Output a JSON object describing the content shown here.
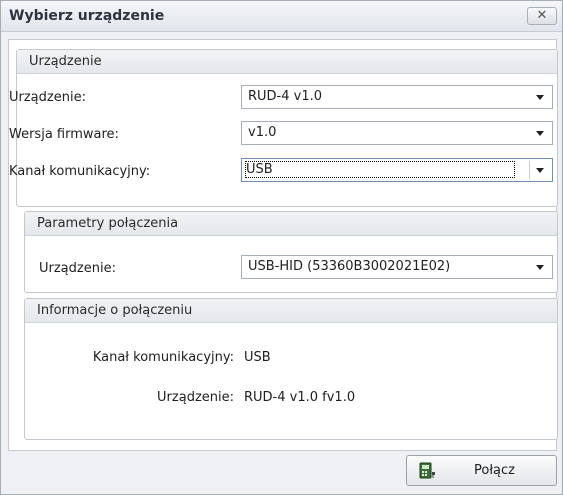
{
  "window": {
    "title": "Wybierz urządzenie",
    "close_glyph": "✕"
  },
  "device_group": {
    "header": "Urządzenie",
    "device_label": "Urządzenie:",
    "device_value": "RUD-4 v1.0",
    "firmware_label": "Wersja firmware:",
    "firmware_value": "v1.0",
    "channel_label": "Kanał komunikacyjny:",
    "channel_value": "USB"
  },
  "connection_params": {
    "header": "Parametry połączenia",
    "device_label": "Urządzenie:",
    "device_value": "USB-HID (53360B3002021E02)"
  },
  "connection_info": {
    "header": "Informacje o połączeniu",
    "channel_label": "Kanał komunikacyjny:",
    "channel_value": "USB",
    "device_label": "Urządzenie:",
    "device_value": "RUD-4 v1.0 fv1.0"
  },
  "footer": {
    "connect_label": "Połącz",
    "connect_icon": "connect-device-icon"
  }
}
